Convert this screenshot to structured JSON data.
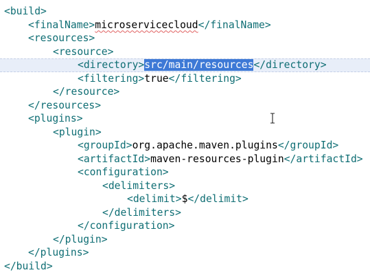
{
  "lines": [
    {
      "open": "<build>",
      "value": "",
      "close": ""
    },
    {
      "open": "<finalName>",
      "value": "microservicecloud",
      "close": "</finalName>"
    },
    {
      "open": "<resources>",
      "value": "",
      "close": ""
    },
    {
      "open": "<resource>",
      "value": "",
      "close": ""
    },
    {
      "open": "<directory>",
      "value": "src/main/resources",
      "close": "</directory>"
    },
    {
      "open": "<filtering>",
      "value": "true",
      "close": "</filtering>"
    },
    {
      "open": "</resource>",
      "value": "",
      "close": ""
    },
    {
      "open": "</resources>",
      "value": "",
      "close": ""
    },
    {
      "open": "<plugins>",
      "value": "",
      "close": ""
    },
    {
      "open": "<plugin>",
      "value": "",
      "close": ""
    },
    {
      "open": "<groupId>",
      "value": "org.apache.maven.plugins",
      "close": "</groupId>"
    },
    {
      "open": "<artifactId>",
      "value": "maven-resources-plugin",
      "close": "</artifactId>"
    },
    {
      "open": "<configuration>",
      "value": "",
      "close": ""
    },
    {
      "open": "<delimiters>",
      "value": "",
      "close": ""
    },
    {
      "open": "<delimit>",
      "value": "$",
      "close": "</delimit>"
    },
    {
      "open": "</delimiters>",
      "value": "",
      "close": ""
    },
    {
      "open": "</configuration>",
      "value": "",
      "close": ""
    },
    {
      "open": "</plugin>",
      "value": "",
      "close": ""
    },
    {
      "open": "</plugins>",
      "value": "",
      "close": ""
    },
    {
      "open": "</build>",
      "value": "",
      "close": ""
    }
  ],
  "selection_text": "src/main/resources",
  "cursor_icon": "text-cursor-icon",
  "colors": {
    "tag": "#0f6e74",
    "selection": "#3d79d6",
    "current_line": "#e8eef9",
    "spell_underline": "#e06060"
  }
}
